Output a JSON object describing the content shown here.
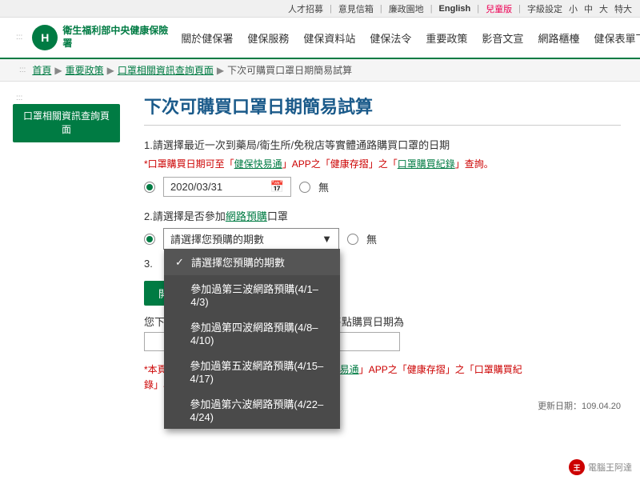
{
  "topbar": {
    "recruitment": "人才招募",
    "mailbox": "意見信箱",
    "廉政": "廉政園地",
    "english": "English",
    "children": "兒童版",
    "font_label": "字級設定",
    "font_small": "小",
    "font_mid": "中",
    "font_large": "大",
    "font_xlarge": "特大"
  },
  "header": {
    "logo_letter": "H",
    "logo_text": "衛生福利部中央健康保險署",
    "nav_items": [
      "關於健保署",
      "健保服務",
      "健保資料站",
      "健保法令",
      "重要政策",
      "影音文宣",
      "網路櫃檯",
      "健保表單下載"
    ]
  },
  "breadcrumb": {
    "home": "首頁",
    "sep1": "▶",
    "level2": "重要政策",
    "sep2": "▶",
    "level3": "口罩相關資訊查詢頁面",
    "sep3": "▶",
    "current": "下次可購買口罩日期簡易試算"
  },
  "sidebar": {
    "btn_label": "口罩相關資訊查詢頁面"
  },
  "main": {
    "page_title": "下次可購買口罩日期簡易試算",
    "section1_label": "1.請選擇最近一次到藥局/衛生所/免稅店等實體通路購買口罩的日期",
    "note1": "*口罩購買日期可至「健保快易通」APP之「健康存摺」之「口罩購買紀錄」查詢。",
    "date_value": "2020/03/31",
    "wu_label": "無",
    "section2_label": "2.請選擇是否參加網路預購口罩",
    "dropdown_placeholder": "請選擇您預購的期數",
    "dropdown_wu": "無",
    "dropdown_options": [
      "請選擇您預購的期數",
      "參加過第三波網路預購(4/1–4/3)",
      "參加過第四波網路預購(4/8–4/10)",
      "參加過第五波網路預購(4/15–4/17)",
      "參加過第六波網路預購(4/22–4/24)"
    ],
    "section3_label": "3.",
    "start_btn": "開始查詢",
    "result_label": "您下次可到實體特約院所、特約藥局等販售點購買日期為",
    "result_value": "",
    "footer_note": "*本頁面為簡易試算，實際可購買日以「健保快易通」APP之「健康存摺」之「口罩購買紀錄」為準。",
    "update_date": "更新日期：109.04.20"
  },
  "watermark": {
    "icon": "電",
    "text": "電腦王阿達"
  }
}
